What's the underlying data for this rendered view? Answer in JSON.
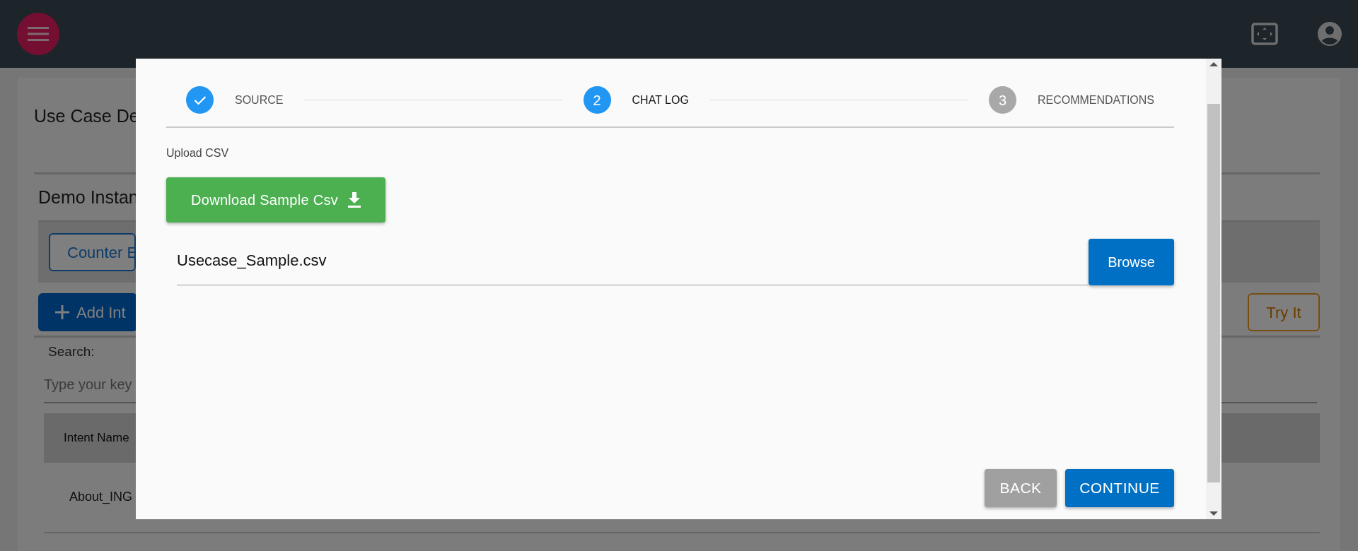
{
  "background": {
    "page_title": "Use Case De",
    "section_title": "Demo Instan",
    "tab_button": "Counter E",
    "add_button": "Add Int",
    "try_button": "Try It",
    "search": {
      "label": "Search:",
      "placeholder": "Type your key"
    },
    "table": {
      "columns": [
        "Intent Name"
      ],
      "rows": [
        [
          "About_ING"
        ]
      ]
    }
  },
  "modal": {
    "steps": [
      {
        "label": "SOURCE",
        "done": true,
        "selected": false
      },
      {
        "number": "2",
        "label": "CHAT LOG",
        "done": false,
        "selected": true
      },
      {
        "number": "3",
        "label": "RECOMMENDATIONS",
        "done": false,
        "selected": false
      }
    ],
    "upload_label": "Upload CSV",
    "download_button": "Download Sample Csv",
    "file_field": {
      "value": "Usecase_Sample.csv"
    },
    "browse_button": "Browse",
    "buttons": [
      {
        "label": "BACK",
        "kind": "secondary"
      },
      {
        "label": "CONTINUE",
        "kind": "primary"
      }
    ]
  }
}
